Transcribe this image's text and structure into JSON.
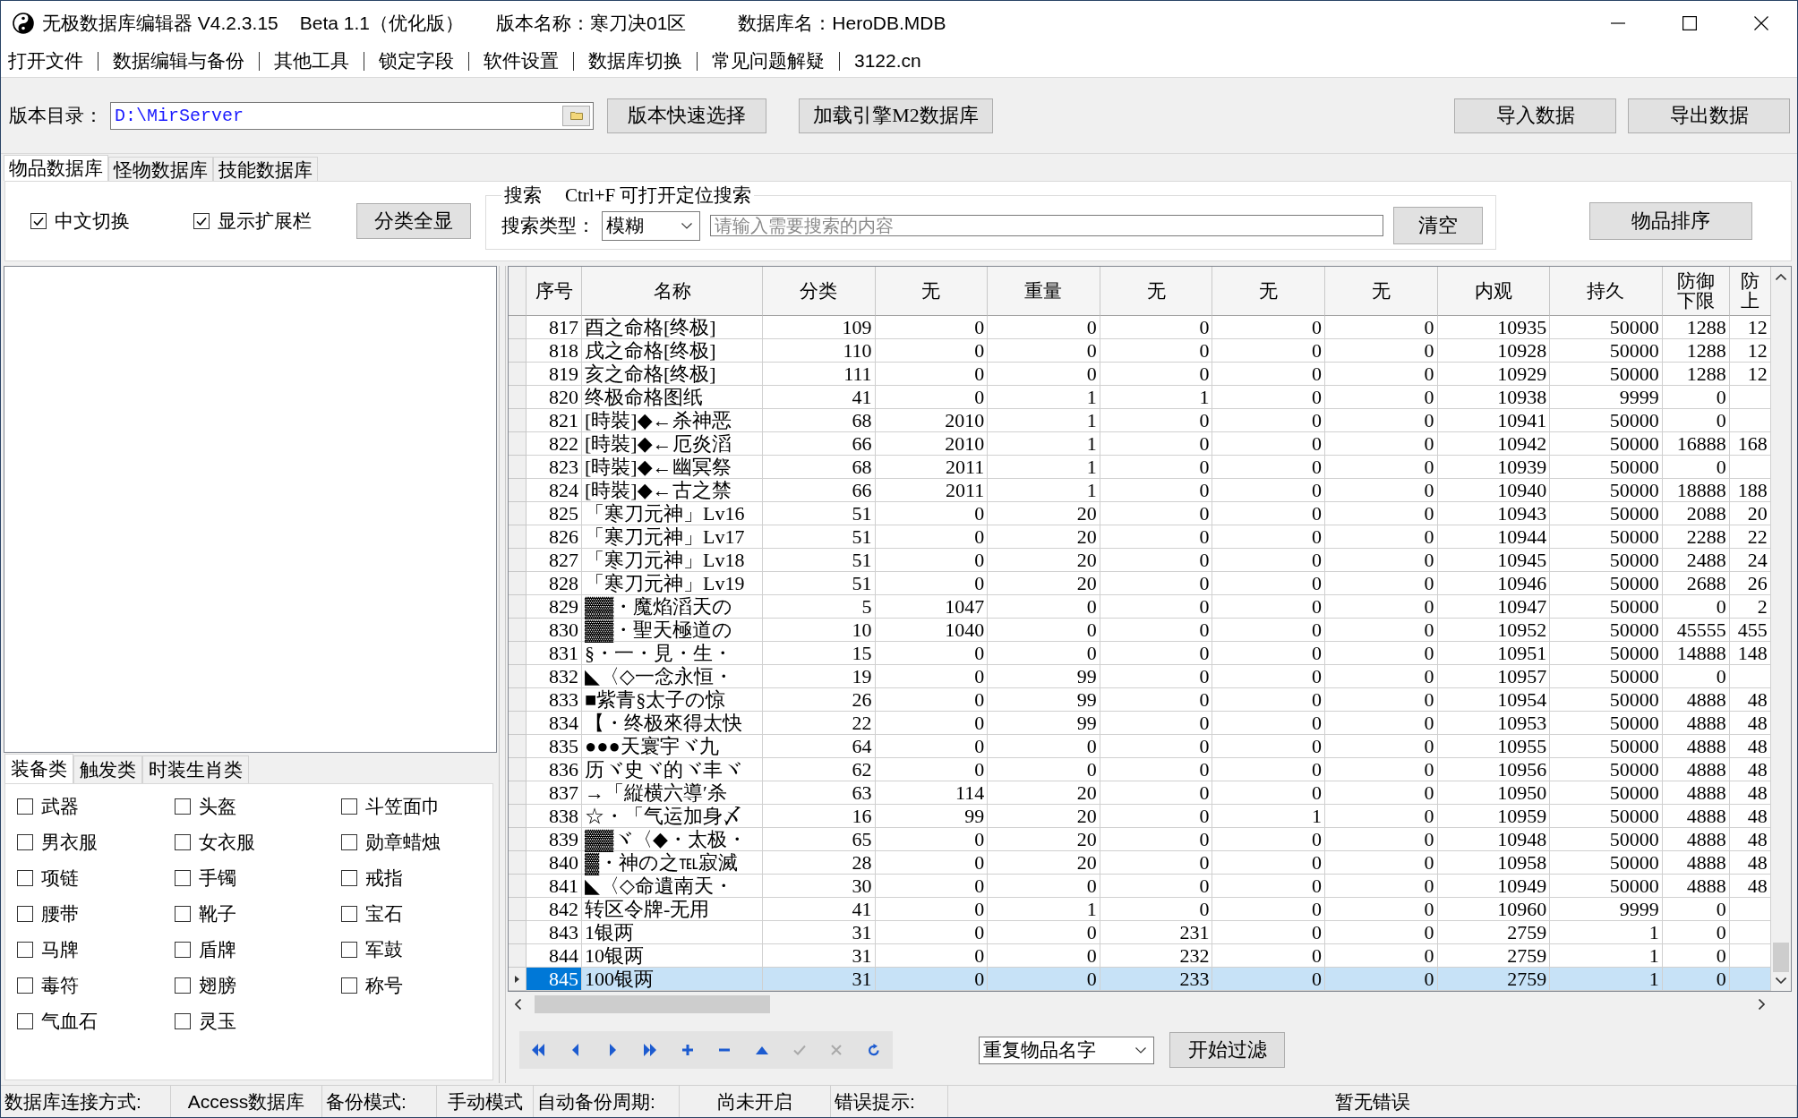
{
  "title_bar": {
    "app_title": "无极数据库编辑器 V4.2.3.15",
    "edition": "Beta 1.1（优化版）",
    "version_name": "版本名称：寒刀决01区",
    "database_name": "数据库名：HeroDB.MDB"
  },
  "menu": [
    "打开文件",
    "数据编辑与备份",
    "其他工具",
    "锁定字段",
    "软件设置",
    "数据库切换",
    "常见问题解疑",
    "3122.cn"
  ],
  "toolbar": {
    "directory_label": "版本目录：",
    "directory_value": "D:\\MirServer",
    "left_buttons": [
      "版本快速选择",
      "加载引擎M2数据库"
    ],
    "right_buttons": [
      "导入数据",
      "导出数据"
    ]
  },
  "tabs": [
    {
      "label": "物品数据库",
      "selected": true
    },
    {
      "label": "怪物数据库",
      "selected": false
    },
    {
      "label": "技能数据库",
      "selected": false
    }
  ],
  "options": {
    "checkboxes": [
      {
        "label": "中文切换",
        "checked": true
      },
      {
        "label": "显示扩展栏",
        "checked": true
      }
    ],
    "show_all_button": "分类全显",
    "search": {
      "legend": "搜索",
      "hint": "Ctrl+F 可打开定位搜索",
      "type_label": "搜索类型：",
      "type_value": "模糊",
      "placeholder": "请输入需要搜索的内容",
      "clear_button": "清空"
    },
    "sort_button": "物品排序"
  },
  "category_tabs": [
    {
      "label": "装备类",
      "selected": true
    },
    {
      "label": "触发类",
      "selected": false
    },
    {
      "label": "时装生肖类",
      "selected": false
    }
  ],
  "categories": [
    {
      "label": "武器",
      "checked": false
    },
    {
      "label": "头盔",
      "checked": false
    },
    {
      "label": "斗笠面巾",
      "checked": false
    },
    {
      "label": "男衣服",
      "checked": false
    },
    {
      "label": "女衣服",
      "checked": false
    },
    {
      "label": "勋章蜡烛",
      "checked": false
    },
    {
      "label": "项链",
      "checked": false
    },
    {
      "label": "手镯",
      "checked": false
    },
    {
      "label": "戒指",
      "checked": false
    },
    {
      "label": "腰带",
      "checked": false
    },
    {
      "label": "靴子",
      "checked": false
    },
    {
      "label": "宝石",
      "checked": false
    },
    {
      "label": "马牌",
      "checked": false
    },
    {
      "label": "盾牌",
      "checked": false
    },
    {
      "label": "军鼓",
      "checked": false
    },
    {
      "label": "毒符",
      "checked": false
    },
    {
      "label": "翅膀",
      "checked": false
    },
    {
      "label": "称号",
      "checked": false
    },
    {
      "label": "气血石",
      "checked": false
    },
    {
      "label": "灵玉",
      "checked": false
    }
  ],
  "table": {
    "columns": [
      {
        "label": "序号"
      },
      {
        "label": "名称"
      },
      {
        "label": "分类"
      },
      {
        "label": "无"
      },
      {
        "label": "重量"
      },
      {
        "label": "无"
      },
      {
        "label": "无"
      },
      {
        "label": "无"
      },
      {
        "label": "内观"
      },
      {
        "label": "持久"
      },
      {
        "label": "防御下限"
      },
      {
        "label": "防上"
      }
    ],
    "rows": [
      {
        "cells": [
          "817",
          "酉之命格[终极]",
          "109",
          "0",
          "0",
          "0",
          "0",
          "0",
          "10935",
          "50000",
          "1288",
          "12"
        ],
        "selected": false
      },
      {
        "cells": [
          "818",
          "戌之命格[终极]",
          "110",
          "0",
          "0",
          "0",
          "0",
          "0",
          "10928",
          "50000",
          "1288",
          "12"
        ],
        "selected": false
      },
      {
        "cells": [
          "819",
          "亥之命格[终极]",
          "111",
          "0",
          "0",
          "0",
          "0",
          "0",
          "10929",
          "50000",
          "1288",
          "12"
        ],
        "selected": false
      },
      {
        "cells": [
          "820",
          "终极命格图纸",
          "41",
          "0",
          "1",
          "1",
          "0",
          "0",
          "10938",
          "9999",
          "0"
        ],
        "selected": false
      },
      {
        "cells": [
          "821",
          "[時裝]◆←杀神恶",
          "68",
          "2010",
          "1",
          "0",
          "0",
          "0",
          "10941",
          "50000",
          "0"
        ],
        "selected": false
      },
      {
        "cells": [
          "822",
          "[時裝]◆←厄炎滔",
          "66",
          "2010",
          "1",
          "0",
          "0",
          "0",
          "10942",
          "50000",
          "16888",
          "168"
        ],
        "selected": false
      },
      {
        "cells": [
          "823",
          "[時裝]◆←幽冥祭",
          "68",
          "2011",
          "1",
          "0",
          "0",
          "0",
          "10939",
          "50000",
          "0"
        ],
        "selected": false
      },
      {
        "cells": [
          "824",
          "[時裝]◆←古之禁",
          "66",
          "2011",
          "1",
          "0",
          "0",
          "0",
          "10940",
          "50000",
          "18888",
          "188"
        ],
        "selected": false
      },
      {
        "cells": [
          "825",
          "「寒刀元神」Lv16",
          "51",
          "0",
          "20",
          "0",
          "0",
          "0",
          "10943",
          "50000",
          "2088",
          "20"
        ],
        "selected": false
      },
      {
        "cells": [
          "826",
          "「寒刀元神」Lv17",
          "51",
          "0",
          "20",
          "0",
          "0",
          "0",
          "10944",
          "50000",
          "2288",
          "22"
        ],
        "selected": false
      },
      {
        "cells": [
          "827",
          "「寒刀元神」Lv18",
          "51",
          "0",
          "20",
          "0",
          "0",
          "0",
          "10945",
          "50000",
          "2488",
          "24"
        ],
        "selected": false
      },
      {
        "cells": [
          "828",
          "「寒刀元神」Lv19",
          "51",
          "0",
          "20",
          "0",
          "0",
          "0",
          "10946",
          "50000",
          "2688",
          "26"
        ],
        "selected": false
      },
      {
        "cells": [
          "829",
          "▓▓・魔焰滔天の",
          "5",
          "1047",
          "0",
          "0",
          "0",
          "0",
          "10947",
          "50000",
          "0",
          "2"
        ],
        "selected": false
      },
      {
        "cells": [
          "830",
          "▓▓・聖天極道の",
          "10",
          "1040",
          "0",
          "0",
          "0",
          "0",
          "10952",
          "50000",
          "45555",
          "455"
        ],
        "selected": false
      },
      {
        "cells": [
          "831",
          "§・一・見・生・",
          "15",
          "0",
          "0",
          "0",
          "0",
          "0",
          "10951",
          "50000",
          "14888",
          "148"
        ],
        "selected": false
      },
      {
        "cells": [
          "832",
          "◣〈◇一念永恒・",
          "19",
          "0",
          "99",
          "0",
          "0",
          "0",
          "10957",
          "50000",
          "0"
        ],
        "selected": false
      },
      {
        "cells": [
          "833",
          "■紫青§太子の惊",
          "26",
          "0",
          "99",
          "0",
          "0",
          "0",
          "10954",
          "50000",
          "4888",
          "48"
        ],
        "selected": false
      },
      {
        "cells": [
          "834",
          "【・终极來得太快",
          "22",
          "0",
          "99",
          "0",
          "0",
          "0",
          "10953",
          "50000",
          "4888",
          "48"
        ],
        "selected": false
      },
      {
        "cells": [
          "835",
          "●●●天寰宇ヾ九",
          "64",
          "0",
          "0",
          "0",
          "0",
          "0",
          "10955",
          "50000",
          "4888",
          "48"
        ],
        "selected": false
      },
      {
        "cells": [
          "836",
          "历ヾ史ヾ的ヾ丰ヾ",
          "62",
          "0",
          "0",
          "0",
          "0",
          "0",
          "10956",
          "50000",
          "4888",
          "48"
        ],
        "selected": false
      },
      {
        "cells": [
          "837",
          "→「縦横六導′杀",
          "63",
          "114",
          "20",
          "0",
          "0",
          "0",
          "10950",
          "50000",
          "4888",
          "48"
        ],
        "selected": false
      },
      {
        "cells": [
          "838",
          "☆・「气运加身〆",
          "16",
          "99",
          "20",
          "0",
          "1",
          "0",
          "10959",
          "50000",
          "4888",
          "48"
        ],
        "selected": false
      },
      {
        "cells": [
          "839",
          "▓▓ヾ〈◆・太极・",
          "65",
          "0",
          "20",
          "0",
          "0",
          "0",
          "10948",
          "50000",
          "4888",
          "48"
        ],
        "selected": false
      },
      {
        "cells": [
          "840",
          "▓・神の之℡寂滅",
          "28",
          "0",
          "20",
          "0",
          "0",
          "0",
          "10958",
          "50000",
          "4888",
          "48"
        ],
        "selected": false
      },
      {
        "cells": [
          "841",
          "◣〈◇命遺南天・",
          "30",
          "0",
          "0",
          "0",
          "0",
          "0",
          "10949",
          "50000",
          "4888",
          "48"
        ],
        "selected": false
      },
      {
        "cells": [
          "842",
          "转区令牌-无用",
          "41",
          "0",
          "1",
          "0",
          "0",
          "0",
          "10960",
          "9999",
          "0"
        ],
        "selected": false
      },
      {
        "cells": [
          "843",
          "1银两",
          "31",
          "0",
          "0",
          "231",
          "0",
          "0",
          "2759",
          "1",
          "0"
        ],
        "selected": false
      },
      {
        "cells": [
          "844",
          "10银两",
          "31",
          "0",
          "0",
          "232",
          "0",
          "0",
          "2759",
          "1",
          "0"
        ],
        "selected": false
      },
      {
        "cells": [
          "845",
          "100银两",
          "31",
          "0",
          "0",
          "233",
          "0",
          "0",
          "2759",
          "1",
          "0"
        ],
        "selected": true
      }
    ]
  },
  "navigator": [
    {
      "kind": "first",
      "disabled": false
    },
    {
      "kind": "prior",
      "disabled": false
    },
    {
      "kind": "next",
      "disabled": false
    },
    {
      "kind": "last",
      "disabled": false
    },
    {
      "kind": "insert",
      "disabled": false
    },
    {
      "kind": "delete",
      "disabled": false
    },
    {
      "kind": "edit",
      "disabled": false
    },
    {
      "kind": "post",
      "disabled": true
    },
    {
      "kind": "cancel",
      "disabled": true
    },
    {
      "kind": "refresh",
      "disabled": false
    }
  ],
  "filter": {
    "value": "重复物品名字",
    "button": "开始过滤"
  },
  "status_bar": [
    {
      "kind": "label",
      "text": "数据库连接方式:"
    },
    {
      "kind": "value",
      "text": "Access数据库"
    },
    {
      "kind": "label",
      "text": "备份模式:"
    },
    {
      "kind": "value",
      "text": "手动模式"
    },
    {
      "kind": "label",
      "text": "自动备份周期:"
    },
    {
      "kind": "value",
      "text": "尚未开启"
    },
    {
      "kind": "label",
      "text": "错误提示:"
    },
    {
      "kind": "value",
      "text": "暂无错误"
    }
  ]
}
